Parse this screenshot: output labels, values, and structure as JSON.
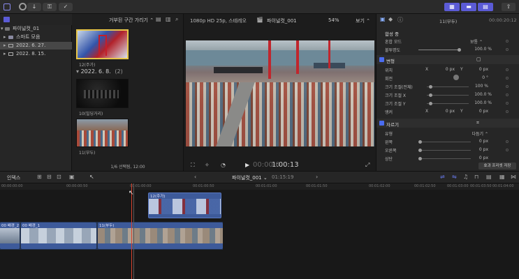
{
  "topbar": {
    "import_icon": "↓",
    "keyword_icon": "⚿",
    "check_icon": "✓"
  },
  "sidebar": {
    "items": [
      {
        "label": "파이널컷_01",
        "icon": "library-icon"
      },
      {
        "label": "스마트 모음",
        "icon": "folder-icon"
      },
      {
        "label": "2022. 6. 27.",
        "icon": "event-icon"
      },
      {
        "label": "2022. 8. 15.",
        "icon": "event-icon"
      }
    ]
  },
  "browser": {
    "filter_label": "거부된 구간 가리기 ⌃",
    "clip_top_label": "12(주가)",
    "date_header": "2022. 6. 8.",
    "date_count": "(2)",
    "clip2_label": "10(빌딩거리)",
    "clip3_label": "11(부두)",
    "status": "1/6 선택됨, 12:00"
  },
  "viewer": {
    "format": "1080p HD 25p, 스테레오",
    "project": "파이널컷_001",
    "zoom": "54%",
    "view_label": "보기 ⌃",
    "timecode": "1:00:13",
    "timecode_prefix": "00:00:0"
  },
  "inspector": {
    "clip_name": "11(부두)",
    "duration": "00:00:20:12",
    "composite_header": "합성 중",
    "blend_mode_label": "혼합 모드",
    "blend_mode_value": "보통 ⌃",
    "opacity_label": "불투명도",
    "opacity_value": "100.0 %",
    "transform_header": "변형",
    "position_label": "위치",
    "pos_x_label": "X",
    "pos_x": "0 px",
    "pos_y_label": "Y",
    "pos_y": "0 px",
    "rotation_label": "회전",
    "rotation_value": "0 °",
    "scale_all_label": "크기 조절(전체)",
    "scale_all": "100 %",
    "scale_x_label": "크기 조절 X",
    "scale_x": "100.0 %",
    "scale_y_label": "크기 조절 Y",
    "scale_y": "100.0 %",
    "anchor_label": "앵커",
    "anchor_x_label": "X",
    "anchor_x": "0 px",
    "anchor_y_label": "Y",
    "anchor_y": "0 px",
    "crop_header": "자르기",
    "type_label": "유형",
    "type_value": "다듬기 ⌃",
    "left_label": "왼쪽",
    "left_value": "0 px",
    "right_label": "오른쪽",
    "right_value": "0 px",
    "top_label": "상단",
    "top_value": "0 px",
    "save_preset": "효과 프리셋 저장"
  },
  "timeline": {
    "index_label": "인덱스",
    "project_name": "파이널컷_001 ⌄",
    "duration": "01:15:19",
    "ruler_ticks": [
      "00:00:00:00",
      "00:00:00:50",
      "00:01:00:00",
      "00:01:00:50",
      "00:01:01:00",
      "00:01:01:50",
      "00:01:02:00",
      "00:01:02:50",
      "00:01:03:00",
      "00:01:03:50",
      "00:01:04:00"
    ],
    "clips": {
      "connected": "12(주가)",
      "c1": "00 배경_2",
      "c2": "00 배경_1",
      "c3": "11(부두)"
    }
  },
  "colors": {
    "accent": "#5b5bd6",
    "selection": "#e8c64a",
    "playhead": "#d9412c",
    "clip_blue": "#3d5a9a"
  }
}
